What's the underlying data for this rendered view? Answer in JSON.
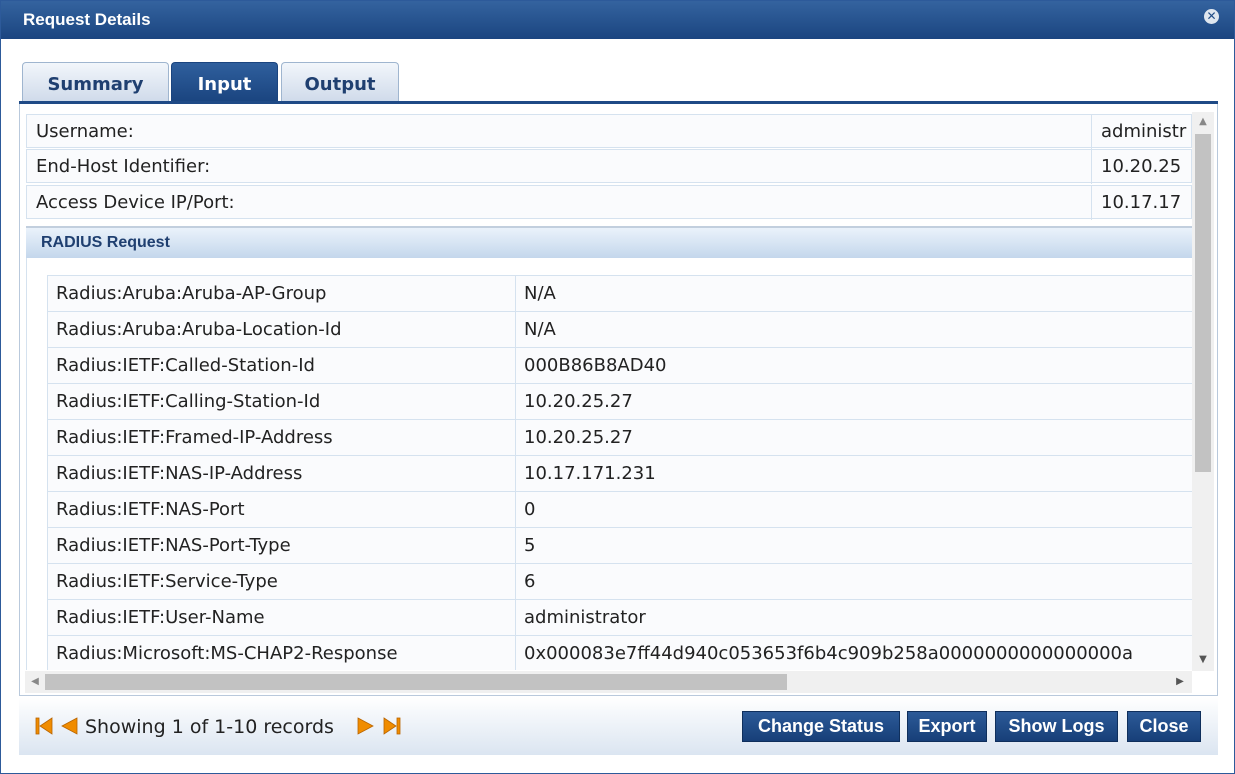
{
  "dialog": {
    "title": "Request Details"
  },
  "tabs": [
    {
      "label": "Summary",
      "active": false
    },
    {
      "label": "Input",
      "active": true
    },
    {
      "label": "Output",
      "active": false
    }
  ],
  "summary_fields": [
    {
      "label": "Username:",
      "value": "administr"
    },
    {
      "label": "End-Host Identifier:",
      "value": "10.20.25"
    },
    {
      "label": "Access Device IP/Port:",
      "value": "10.17.17"
    }
  ],
  "radius": {
    "header": "RADIUS Request",
    "rows": [
      {
        "key": "Radius:Aruba:Aruba-AP-Group",
        "value": "N/A"
      },
      {
        "key": "Radius:Aruba:Aruba-Location-Id",
        "value": "N/A"
      },
      {
        "key": "Radius:IETF:Called-Station-Id",
        "value": "000B86B8AD40"
      },
      {
        "key": "Radius:IETF:Calling-Station-Id",
        "value": "10.20.25.27"
      },
      {
        "key": "Radius:IETF:Framed-IP-Address",
        "value": "10.20.25.27"
      },
      {
        "key": "Radius:IETF:NAS-IP-Address",
        "value": "10.17.171.231"
      },
      {
        "key": "Radius:IETF:NAS-Port",
        "value": "0"
      },
      {
        "key": "Radius:IETF:NAS-Port-Type",
        "value": "5"
      },
      {
        "key": "Radius:IETF:Service-Type",
        "value": "6"
      },
      {
        "key": "Radius:IETF:User-Name",
        "value": "administrator"
      },
      {
        "key": "Radius:Microsoft:MS-CHAP2-Response",
        "value": "0x000083e7ff44d940c053653f6b4c909b258a0000000000000000a"
      }
    ]
  },
  "footer": {
    "pager_text": "Showing 1 of 1-10 records",
    "buttons": {
      "change_status": "Change Status",
      "export": "Export",
      "show_logs": "Show Logs",
      "close": "Close"
    }
  },
  "colors": {
    "title_bar": "#1f4a86",
    "accent_orange": "#f08c00",
    "button_bg": "#1f4a86"
  }
}
